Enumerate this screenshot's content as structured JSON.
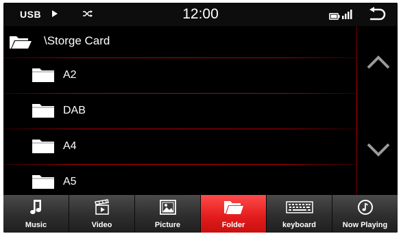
{
  "status_bar": {
    "source": "USB",
    "play_icon": "play-icon",
    "shuffle_icon": "shuffle-icon",
    "time": "12:00",
    "battery_icon": "battery-icon",
    "signal_icon": "signal-icon",
    "back_icon": "back-icon"
  },
  "browser": {
    "path": "\\Storge Card",
    "folders": [
      {
        "name": "A2"
      },
      {
        "name": "DAB"
      },
      {
        "name": "A4"
      },
      {
        "name": "A5"
      }
    ]
  },
  "scroll": {
    "up_icon": "chevron-up-icon",
    "down_icon": "chevron-down-icon"
  },
  "tabs": [
    {
      "label": "Music",
      "icon": "music-note-icon",
      "active": false
    },
    {
      "label": "Video",
      "icon": "video-icon",
      "active": false
    },
    {
      "label": "Picture",
      "icon": "picture-icon",
      "active": false
    },
    {
      "label": "Folder",
      "icon": "folder-icon",
      "active": true
    },
    {
      "label": "keyboard",
      "icon": "keyboard-icon",
      "active": false
    },
    {
      "label": "Now Playing",
      "icon": "now-playing-icon",
      "active": false
    }
  ],
  "colors": {
    "accent": "#e21b1b",
    "separator": "#c40000",
    "background": "#000000"
  }
}
